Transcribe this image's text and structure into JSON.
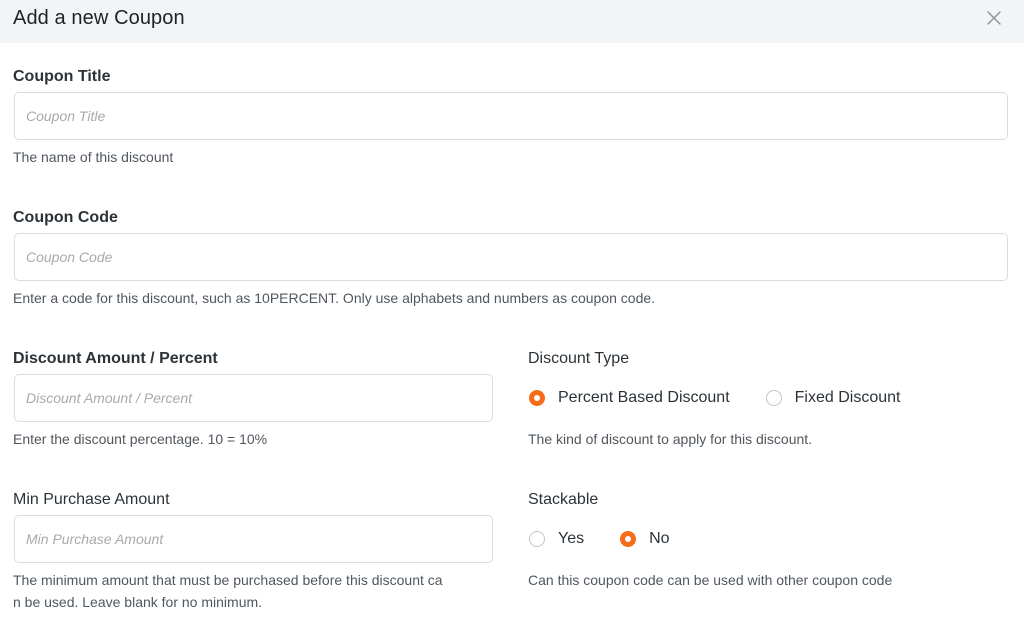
{
  "dialog": {
    "title": "Add a new Coupon",
    "close_icon": "close-icon"
  },
  "coupon_title": {
    "label": "Coupon Title",
    "placeholder": "Coupon Title",
    "value": "",
    "help": "The name of this discount"
  },
  "coupon_code": {
    "label": "Coupon Code",
    "placeholder": "Coupon Code",
    "value": "",
    "help": "Enter a code for this discount, such as 10PERCENT. Only use alphabets and numbers as coupon code."
  },
  "discount_amount": {
    "label": "Discount Amount / Percent",
    "placeholder": "Discount Amount / Percent",
    "value": "",
    "help": "Enter the discount percentage. 10 = 10%"
  },
  "discount_type": {
    "label": "Discount Type",
    "options": [
      {
        "label": "Percent Based Discount",
        "checked": true
      },
      {
        "label": "Fixed Discount",
        "checked": false
      }
    ],
    "help": "The kind of discount to apply for this discount."
  },
  "min_purchase": {
    "label": "Min Purchase Amount",
    "placeholder": "Min Purchase Amount",
    "value": "",
    "help_line1": "The minimum amount that must be purchased before this discount ca",
    "help_line2": "n be used. Leave blank for no minimum."
  },
  "stackable": {
    "label": "Stackable",
    "options": [
      {
        "label": "Yes",
        "checked": false
      },
      {
        "label": "No",
        "checked": true
      }
    ],
    "help": "Can this coupon code can be used with other coupon code"
  },
  "colors": {
    "accent": "#f56c1b",
    "header_bg": "#f3f4f6",
    "border": "#d9dce1"
  }
}
